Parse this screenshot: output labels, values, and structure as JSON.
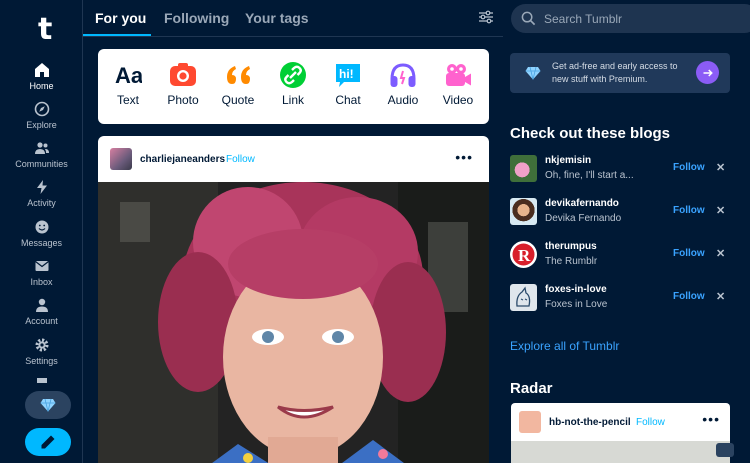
{
  "app": {
    "logo": "t"
  },
  "nav": {
    "items": [
      {
        "label": "Home",
        "icon": "home-icon",
        "active": true
      },
      {
        "label": "Explore",
        "icon": "compass-icon"
      },
      {
        "label": "Communities",
        "icon": "people-icon"
      },
      {
        "label": "Activity",
        "icon": "bolt-icon"
      },
      {
        "label": "Messages",
        "icon": "smiley-icon"
      },
      {
        "label": "Inbox",
        "icon": "envelope-icon"
      },
      {
        "label": "Account",
        "icon": "person-icon"
      },
      {
        "label": "Settings",
        "icon": "gear-icon"
      }
    ],
    "premium_icon": "gem-icon",
    "compose_icon": "pencil-icon"
  },
  "tabs": [
    {
      "label": "For you",
      "active": true
    },
    {
      "label": "Following"
    },
    {
      "label": "Your tags"
    }
  ],
  "post_types": [
    {
      "label": "Text",
      "icon": "text-aa-icon",
      "color": "#001935"
    },
    {
      "label": "Photo",
      "icon": "camera-icon",
      "color": "#ff4930"
    },
    {
      "label": "Quote",
      "icon": "quote-icon",
      "color": "#ff8a00"
    },
    {
      "label": "Link",
      "icon": "link-icon",
      "color": "#00cf35"
    },
    {
      "label": "Chat",
      "icon": "chat-icon",
      "color": "#00b8ff"
    },
    {
      "label": "Audio",
      "icon": "headphones-icon",
      "color": "#7c5cff"
    },
    {
      "label": "Video",
      "icon": "video-camera-icon",
      "color": "#ff62ce"
    }
  ],
  "post": {
    "blog_name": "charliejaneanders",
    "follow_label": "Follow",
    "more_label": "•••"
  },
  "search": {
    "placeholder": "Search Tumblr"
  },
  "premium": {
    "text": "Get ad-free and early access to new stuff with Premium."
  },
  "check_out": {
    "title": "Check out these blogs",
    "blogs": [
      {
        "name": "nkjemisin",
        "subtitle": "Oh, fine, I'll start a...",
        "follow": "Follow",
        "dismiss": "✕"
      },
      {
        "name": "devikafernando",
        "subtitle": "Devika Fernando",
        "follow": "Follow",
        "dismiss": "✕"
      },
      {
        "name": "therumpus",
        "subtitle": "The Rumblr",
        "follow": "Follow",
        "dismiss": "✕"
      },
      {
        "name": "foxes-in-love",
        "subtitle": "Foxes in Love",
        "follow": "Follow",
        "dismiss": "✕"
      }
    ],
    "explore_link": "Explore all of Tumblr"
  },
  "radar": {
    "title": "Radar",
    "blog_name": "hb-not-the-pencil",
    "follow_label": "Follow",
    "more_label": "•••"
  },
  "colors": {
    "background": "#001935",
    "accent": "#00b8ff",
    "premium_arrow": "#8b5cf6"
  }
}
